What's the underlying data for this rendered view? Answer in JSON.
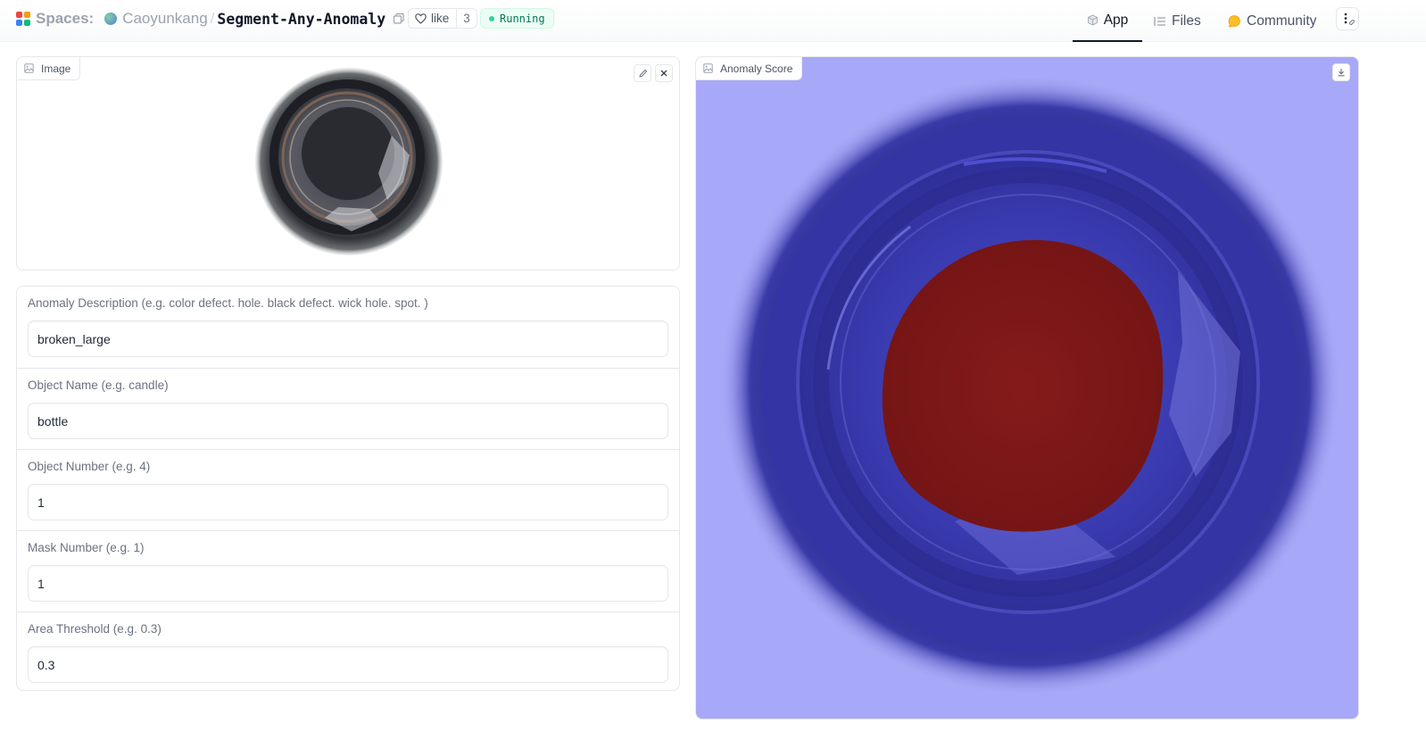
{
  "header": {
    "spaces_label": "Spaces:",
    "owner": "Caoyunkang",
    "separator": "/",
    "repo": "Segment-Any-Anomaly",
    "like_label": "like",
    "like_count": "3",
    "status": "Running",
    "nav": {
      "app": "App",
      "files": "Files",
      "community": "Community"
    }
  },
  "image_panel": {
    "label": "Image"
  },
  "form": {
    "fields": [
      {
        "label": "Anomaly Description (e.g. color defect. hole. black defect. wick hole. spot. )",
        "value": "broken_large"
      },
      {
        "label": "Object Name (e.g. candle)",
        "value": "bottle"
      },
      {
        "label": "Object Number (e.g. 4)",
        "value": "1"
      },
      {
        "label": "Mask Number (e.g. 1)",
        "value": "1"
      },
      {
        "label": "Area Threshold (e.g. 0.3)",
        "value": "0.3"
      }
    ]
  },
  "output_panel": {
    "label": "Anomaly Score"
  },
  "colors": {
    "heatmap_background": "#a8a8f8",
    "bottle_blue": "#3a3ab0",
    "anomaly_red": "#7e1818",
    "status_green": "#047857"
  },
  "icons": [
    "spaces-logo-icon",
    "copy-icon",
    "heart-icon",
    "app-cube-icon",
    "files-icon",
    "community-icon",
    "more-menu-icon",
    "image-icon",
    "edit-icon",
    "close-icon",
    "download-icon"
  ]
}
